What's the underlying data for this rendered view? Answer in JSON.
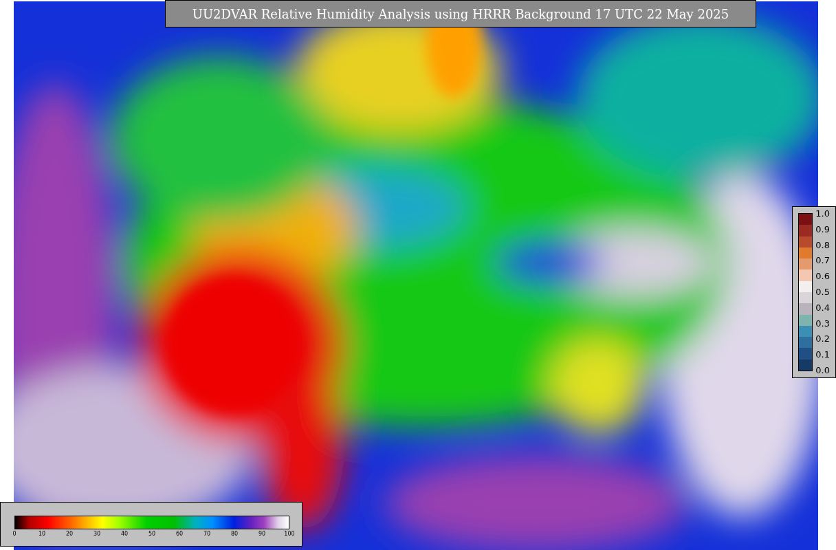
{
  "title": "UU2DVAR Relative Humidity Analysis using HRRR Background 17 UTC 22 May 2025",
  "ratio_colorbar": {
    "ticks": [
      "1.0",
      "0.9",
      "0.8",
      "0.7",
      "0.6",
      "0.5",
      "0.4",
      "0.3",
      "0.2",
      "0.1",
      "0.0"
    ]
  },
  "humidity_colorbar": {
    "ticks": [
      "0",
      "10",
      "20",
      "30",
      "40",
      "50",
      "60",
      "70",
      "80",
      "90",
      "100"
    ]
  }
}
